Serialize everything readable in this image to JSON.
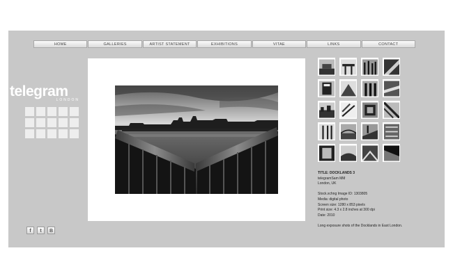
{
  "nav": {
    "items": [
      "HOME",
      "GALLERIES",
      "ARTIST STATEMENT",
      "EXHIBITIONS",
      "VITAE",
      "LINKS",
      "CONTACT"
    ]
  },
  "logo": {
    "main": "telegram",
    "sub": "LONDON"
  },
  "social": {
    "icons": [
      {
        "name": "facebook-icon",
        "glyph": "f"
      },
      {
        "name": "twitter-icon",
        "glyph": "t"
      },
      {
        "name": "blogger-icon",
        "glyph": "B"
      }
    ]
  },
  "photo": {
    "name": "docklands-photo"
  },
  "info": {
    "title": "TITLE: DOCKLANDS 3",
    "author": "telegramSam MM",
    "location": "London, UK",
    "image_id": "Stock.xchng Image ID: 1303805",
    "media": "Media: digital photo",
    "screen_size": "Screen size: 1280 x 853 pixels",
    "print_size": "Print size: 4.3 x 2.8 inches at 300 dpi",
    "date": "Date: 2010",
    "description": "Long exposure shots of the Docklands in East London."
  },
  "colors": {
    "page": "#ffffff",
    "site": "#c8c8c8",
    "panel": "#ffffff",
    "mini_cell": "#eeeeee"
  }
}
